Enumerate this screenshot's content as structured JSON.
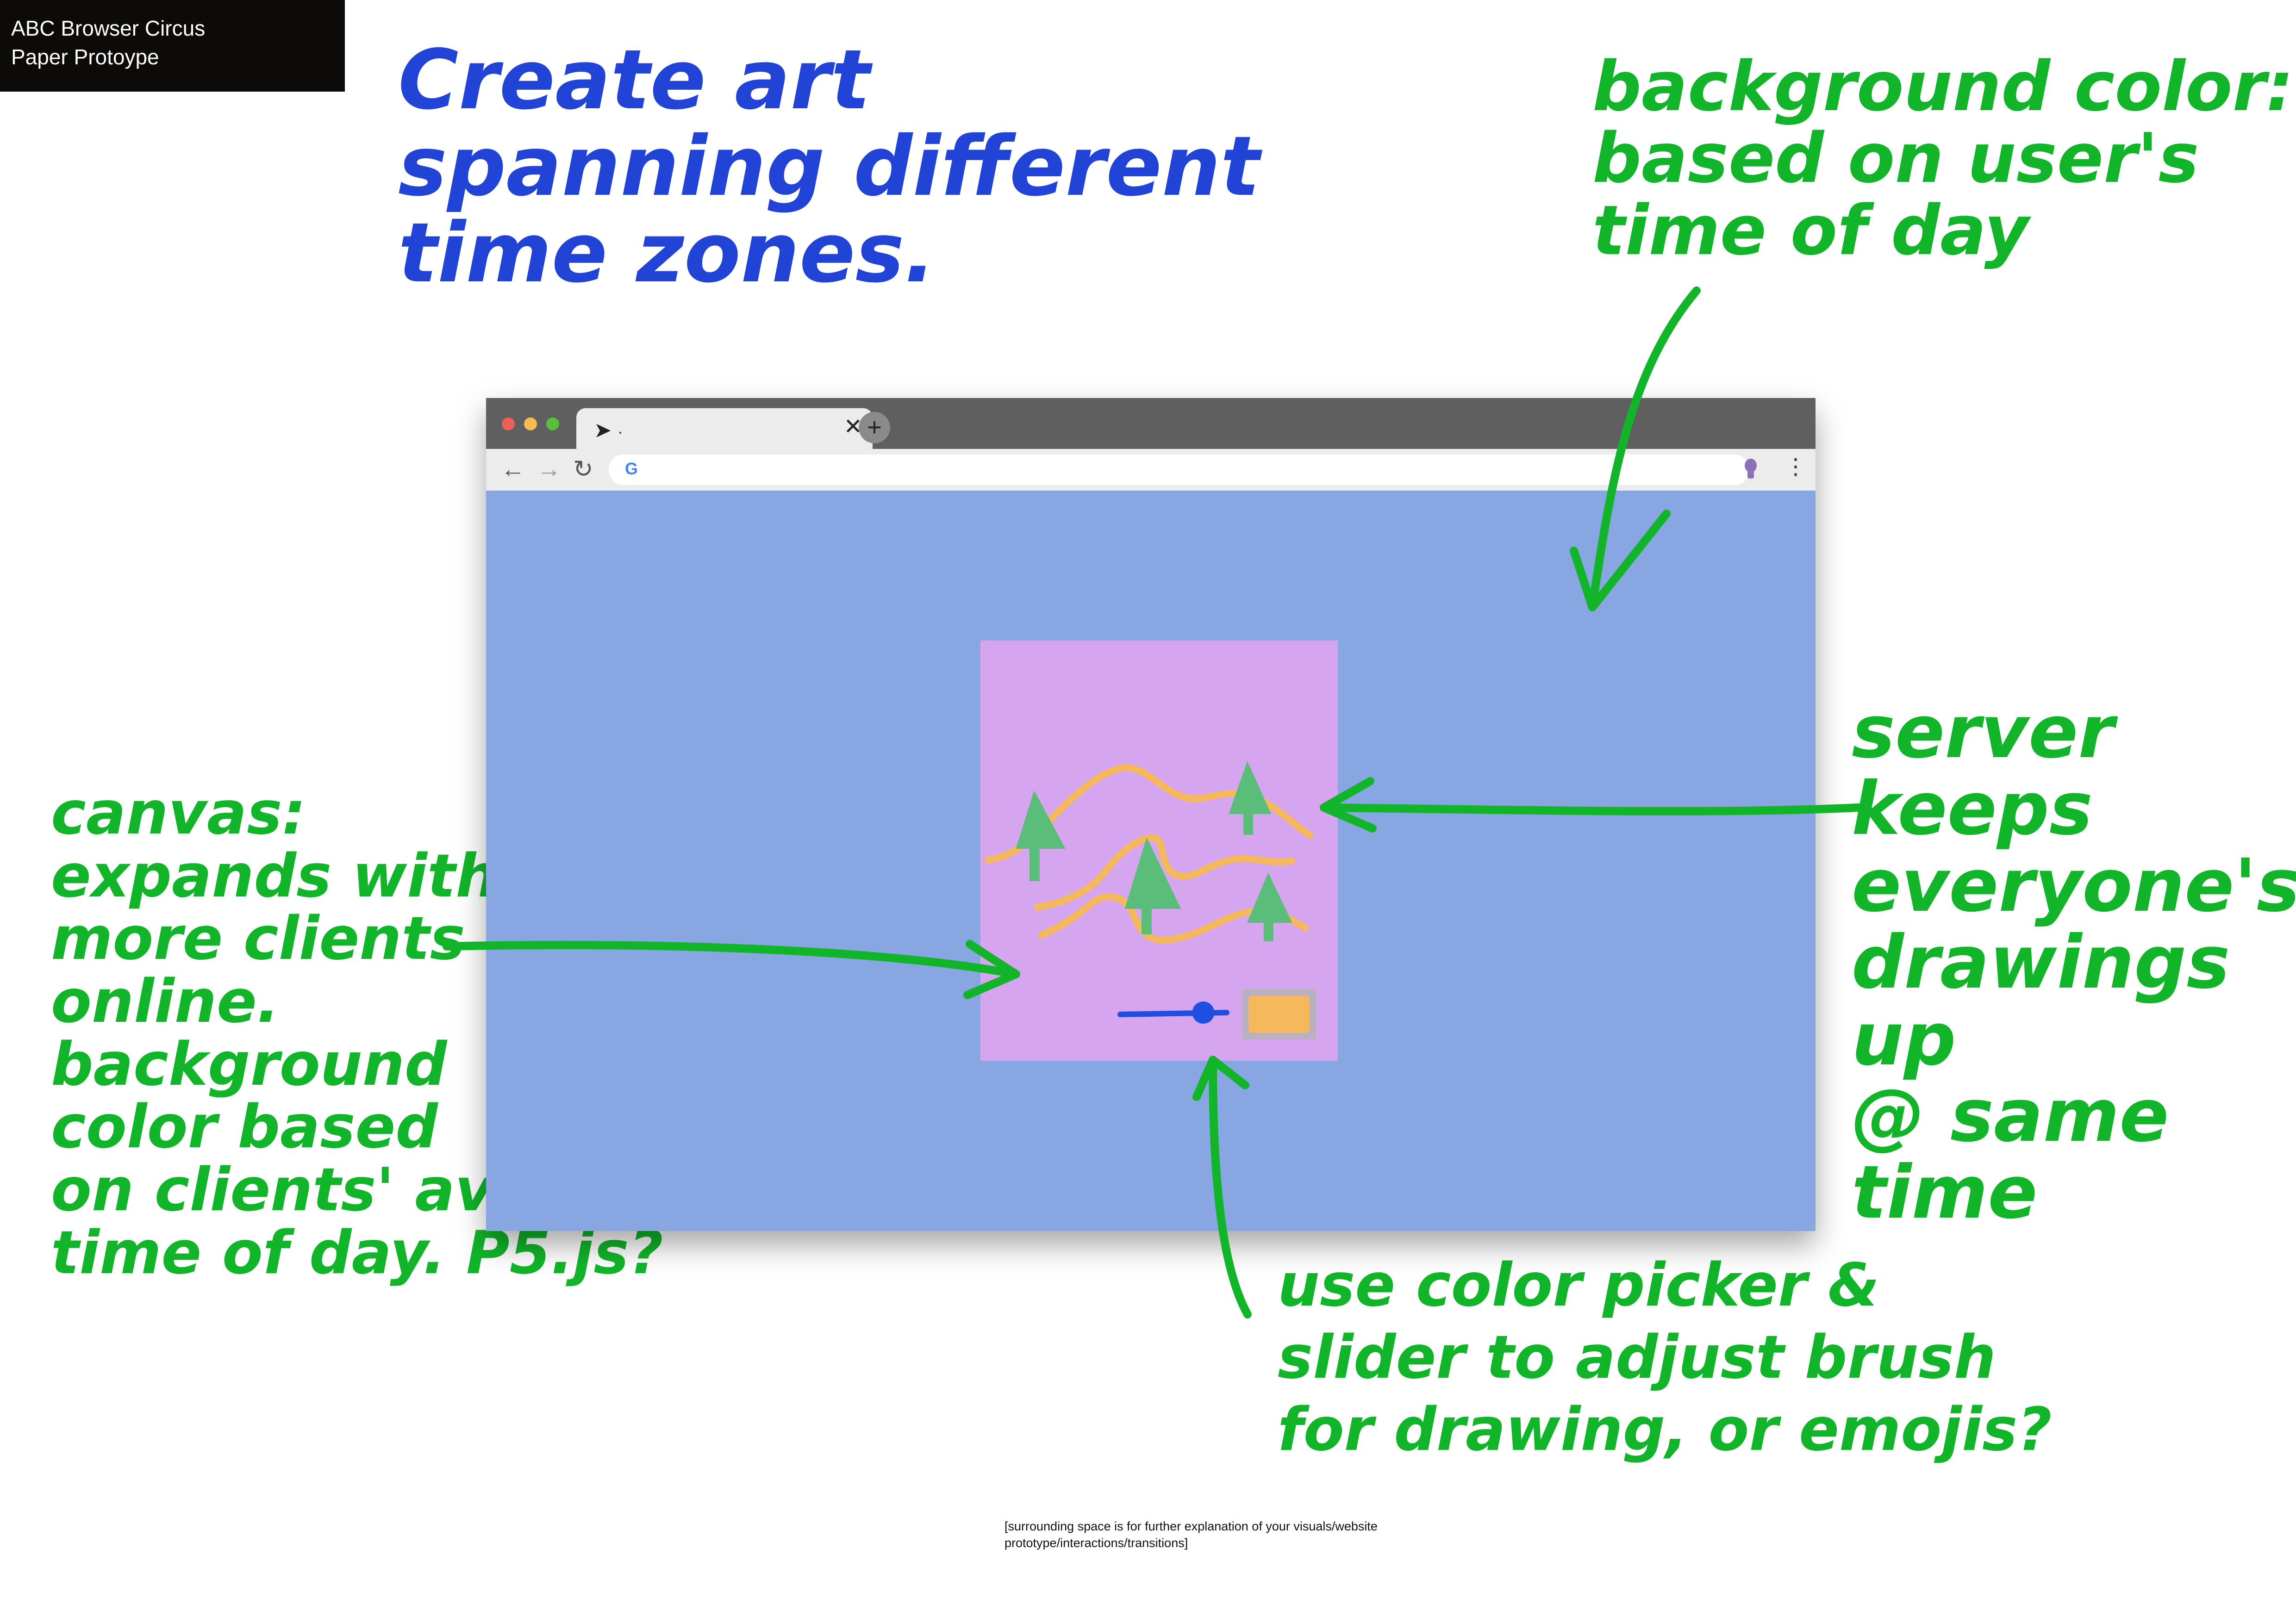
{
  "label_box": {
    "line1": "ABC Browser Circus",
    "line2": "Paper Protoype"
  },
  "title_note": "Create art\nspanning different\ntime zones.",
  "background_note": "background color:\n  based on user's\n     time of day",
  "canvas_note": "canvas:\n expands with\nmore clients\n online.\nbackground\n color based\n on clients' average\n time of day. P5.js?",
  "server_note": "server\nkeeps\neveryone's\ndrawings up\n@ same time",
  "picker_note": "use color picker &\nslider to adjust brush\n  for drawing, or emojis?",
  "footer_note": "[surrounding space is for further explanation of your visuals/website prototype/interactions/transitions]",
  "browser": {
    "tab_title": ".",
    "tab_close": "✕",
    "new_tab": "+",
    "back": "←",
    "forward": "→",
    "reload": "↻",
    "google_glyph": "G",
    "menu": "⋮",
    "address_value": "",
    "page_background_color": "#87a6e2"
  },
  "canvas": {
    "background_color": "#d5a5f0",
    "brush_size_level": 0.78,
    "brush_color": "#f5b95c"
  },
  "colors": {
    "note_green": "#12b52a",
    "note_blue": "#2244d6",
    "tree_green": "#5bbd7a",
    "path_orange": "#f5b95c",
    "slider_blue": "#1f4fe0"
  }
}
